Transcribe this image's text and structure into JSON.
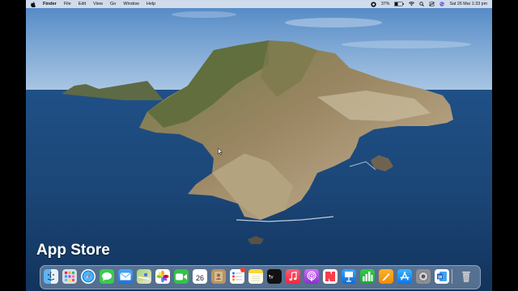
{
  "menubar": {
    "app_name": "Finder",
    "menus": [
      "File",
      "Edit",
      "View",
      "Go",
      "Window",
      "Help"
    ],
    "battery_percent": "37%",
    "datetime": "Sat 26 Mar  1:33 pm"
  },
  "caption": "App Store",
  "dock": {
    "calendar_day": "26",
    "notification_badge_color": "#ff3b30",
    "apps": [
      "finder-icon",
      "launchpad-icon",
      "safari-icon",
      "messages-icon",
      "mail-icon",
      "maps-icon",
      "photos-icon",
      "facetime-icon",
      "calendar-icon",
      "contacts-icon",
      "reminders-icon",
      "notes-icon",
      "appletv-icon",
      "music-icon",
      "podcasts-icon",
      "news-icon",
      "keynote-icon",
      "numbers-icon",
      "pages-icon",
      "appstore-icon",
      "system-preferences-icon",
      "word-icon",
      "trash-icon"
    ]
  },
  "colors": {
    "sea": "#1d4d80",
    "sky": "#6f9fd0",
    "menubar": "#ebeef3"
  }
}
